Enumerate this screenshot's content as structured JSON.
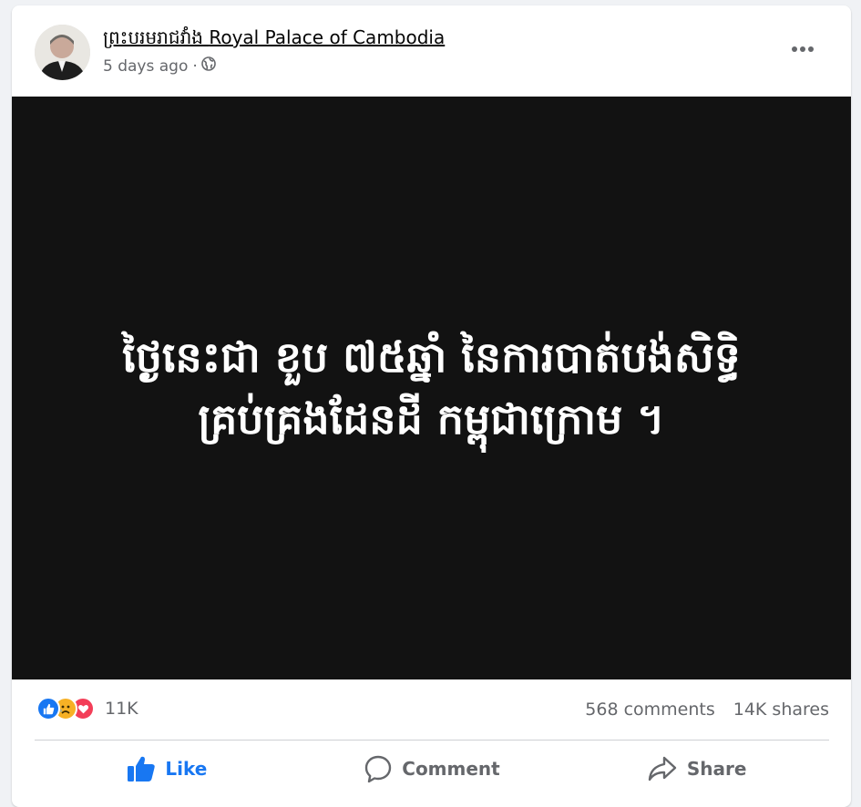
{
  "post": {
    "page_name_khmer": "ព្រះបរមរាជវាំង",
    "page_name_english": "Royal Palace of Cambodia",
    "time_ago": "5 days ago",
    "privacy_icon": "globe-icon",
    "more_icon": "more-options-icon",
    "media_text_line1": "ថ្ងៃនេះជា ខួប ៧៥ឆ្នាំ នៃការបាត់បង់សិទ្ធិ",
    "media_text_line2": "គ្រប់គ្រងដែនដី កម្ពុជាក្រោម ។"
  },
  "stats": {
    "reactions": [
      "like",
      "sad",
      "love"
    ],
    "reaction_count": "11K",
    "comments": "568 comments",
    "shares": "14K shares"
  },
  "actions": {
    "like_label": "Like",
    "comment_label": "Comment",
    "share_label": "Share"
  },
  "colors": {
    "like_blue": "#1877f2",
    "sad_yellow": "#f7b125",
    "love_red": "#f33e58",
    "media_bg": "#121212",
    "muted_text": "#65676b"
  }
}
